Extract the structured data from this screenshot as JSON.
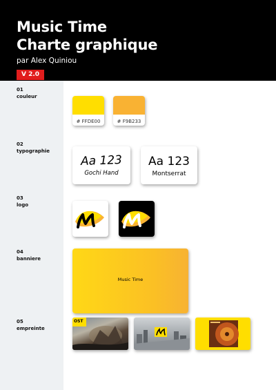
{
  "header": {
    "title_line1": "Music Time",
    "title_line2": "Charte graphique",
    "subtitle": "par Alex Quiniou",
    "version": "V 2.0"
  },
  "sections": [
    {
      "number": "01",
      "label": "couleur"
    },
    {
      "number": "02",
      "label": "typographie"
    },
    {
      "number": "03",
      "label": "logo"
    },
    {
      "number": "04",
      "label": "banniere"
    },
    {
      "number": "05",
      "label": "empreinte"
    }
  ],
  "colors": [
    {
      "hex_label": "# FFDE00",
      "value": "#FFDE00"
    },
    {
      "hex_label": "# F9B233",
      "value": "#F9B233"
    }
  ],
  "typography": [
    {
      "sample": "Aa 123",
      "font_name": "Gochi Hand"
    },
    {
      "sample": "Aa 123",
      "font_name": "Montserrat"
    }
  ],
  "logo": {
    "variants": [
      "logo-on-white",
      "logo-on-black"
    ],
    "colors": {
      "yellow": "#FFDE00",
      "orange": "#F9B233",
      "black": "#000000",
      "white": "#FFFFFF"
    }
  },
  "banner": {
    "text": "Music Time"
  },
  "imprints": [
    {
      "badge": "OST"
    },
    {
      "badge": ""
    },
    {
      "badge": ""
    }
  ],
  "theme": {
    "header_bg": "#000000",
    "version_badge": "#E11D1D",
    "sidebar_bg": "#EEF1F3"
  }
}
